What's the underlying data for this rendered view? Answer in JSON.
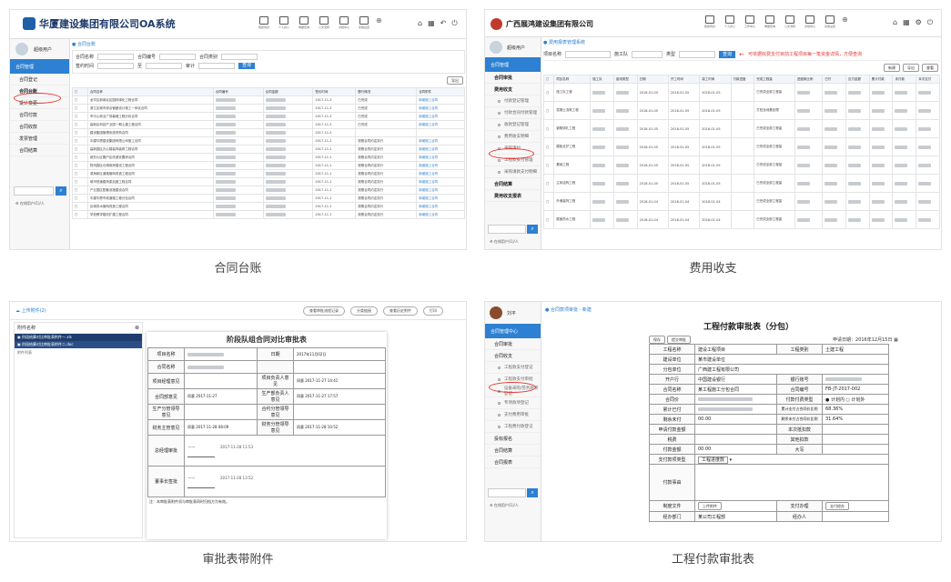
{
  "card1": {
    "caption": "合同台账",
    "logo_text": "华厦建设集团有限公司OA系统",
    "toolbar": [
      "我的待办",
      "个人办公",
      "单据查询",
      "公文流转",
      "文档中心",
      "系统设置"
    ],
    "user": "超级用户",
    "side_header": "合同管理",
    "side_items": [
      "合同登记",
      "合同台账",
      "设计变更",
      "合同付款",
      "合同收款",
      "发票管理",
      "合同结算"
    ],
    "highlighted": "合同台账",
    "online": "在线用户(1)/人",
    "breadcrumb": "合同台账",
    "filter_labels": [
      "合同名称",
      "合同编号",
      "合同类别",
      "签约时间",
      "至",
      "审计",
      "查询"
    ],
    "export_btn": "导出",
    "columns": [
      "合同名称",
      "合同编号",
      "合同金额",
      "签约时间",
      "履行情况",
      "合同附件"
    ],
    "rows": [
      [
        "龙华区新城北区园林绿化工程合同",
        "",
        "",
        "2017-11-3",
        "已完成",
        "新增施工合同"
      ],
      [
        "滨江区城市综合管廊设计施工一体化合同",
        "",
        "",
        "2017-11-2",
        "已完成",
        "新增施工合同"
      ],
      [
        "市中心商业广场幕墙工程分包合同",
        "",
        "",
        "2017-11-2",
        "已完成",
        "新增施工合同"
      ],
      [
        "高新区科技产业园一期土建工程合同",
        "",
        "",
        "2017-11-2",
        "已完成",
        "新增施工合同"
      ],
      [
        "建设集团管理系统采购合同",
        "",
        "",
        "2017-11-2",
        "",
        ""
      ],
      [
        "中建华厦建设集团有限公司施工合同",
        "",
        "",
        "2017-11-1",
        "按照合同约定执行",
        "新增施工合同"
      ],
      [
        "高新园区办公楼装饰装修工程合同",
        "",
        "",
        "2017-11-1",
        "按照合同约定执行",
        "新增施工合同"
      ],
      [
        "城东片区棚户区改造安置房合同",
        "",
        "",
        "2017-11-1",
        "按照合同约定执行",
        "新增施工合同"
      ],
      [
        "物流园区仓储用房建设工程合同",
        "",
        "",
        "2017-11-1",
        "按照合同约定执行",
        "新增施工合同"
      ],
      [
        "滨海新区道路管网改造工程合同",
        "",
        "",
        "2017-11-1",
        "按照合同约定执行",
        "新增施工合同"
      ],
      [
        "城市快速路桥梁加固工程合同",
        "",
        "",
        "2017-11-1",
        "按照合同约定执行",
        "新增施工合同"
      ],
      [
        "产业园区配套设施建设合同",
        "",
        "",
        "2017-11-1",
        "按照合同约定执行",
        "新增施工合同"
      ],
      [
        "中建华厦市政道路工程分包合同",
        "",
        "",
        "2017-11-1",
        "按照合同约定执行",
        "新增施工合同"
      ],
      [
        "区域供水管网改造工程合同",
        "",
        "",
        "2017-11-1",
        "按照合同约定执行",
        "新增施工合同"
      ],
      [
        "学校教学楼改扩建工程合同",
        "",
        "",
        "2017-11-1",
        "按照合同约定执行",
        "新增施工合同"
      ]
    ]
  },
  "card2": {
    "caption": "费用收支",
    "logo_text": "广西展鸿建设集团有限公司",
    "toolbar": [
      "我的待办",
      "个人办公",
      "工作中心",
      "单据查询",
      "公文流转",
      "文档中心",
      "系统设置"
    ],
    "user": "超级用户",
    "side_header": "合同管理",
    "side_items": [
      "合同审批",
      "费用收支",
      "合同结算",
      "费用收支报表"
    ],
    "sub_items": [
      "付款登记管理",
      "付款合同付款管理",
      "收款登记管理",
      "费用收支明细",
      "采购请付",
      "工程款支付管理",
      "采购请款支付明细"
    ],
    "highlighted": "费用收支明细",
    "online": "在线用户(1)/人",
    "breadcrumb": "费用报表管理系统",
    "filter_labels": [
      "项目名称",
      "施工队",
      "类型",
      "查询"
    ],
    "notice": "可依据收费支付目前工程项目每一笔资金详情，方便查询",
    "top_btns": [
      "新建",
      "导出",
      "查看"
    ],
    "columns": [
      "项目名称",
      "施工队",
      "费用类型",
      "日期",
      "开工时间",
      "竣工时间",
      "付款进度",
      "完成工程量",
      "进度款比例",
      "已付",
      "应付金额",
      "累计付款",
      "未付款",
      "本次支付"
    ],
    "rows": [
      [
        "施工队工程",
        "",
        "",
        "2018-01-05",
        "2018-01-05",
        "2018-01-05",
        "",
        "已完成全部工程量"
      ],
      [
        "混凝土浇筑工程",
        "",
        "",
        "2018-01-05",
        "2018-01-05",
        "2018-01-05",
        "",
        "打桩及地基处理"
      ],
      [
        "钢筋绑扎工程",
        "",
        "",
        "2018-01-05",
        "2018-01-05",
        "2018-01-05",
        "",
        "已完成全部工程量"
      ],
      [
        "模板支护工程",
        "",
        "",
        "2018-01-05",
        "2018-01-05",
        "2018-01-05",
        "",
        "已完成全部工程量"
      ],
      [
        "基础工程",
        "",
        "",
        "2018-01-05",
        "2018-01-05",
        "2018-01-05",
        "",
        "已完成全部工程量"
      ],
      [
        "主体结构工程",
        "",
        "",
        "2018-01-05",
        "2018-01-05",
        "2018-01-05",
        "",
        "已完成全部工程量"
      ],
      [
        "外墙装饰工程",
        "",
        "",
        "2018-01-04",
        "2018-01-04",
        "2018-01-04",
        "",
        "已完成全部工程量"
      ],
      [
        "屋面防水工程",
        "",
        "",
        "2018-01-04",
        "2018-01-04",
        "2018-01-04",
        "",
        "已完成全部工程量"
      ]
    ]
  },
  "card3": {
    "caption": "审批表带附件",
    "upload_btn": "上传附件(2)",
    "side_title": "附件名称",
    "files": [
      "阶段结算对比审批表附件一.xls",
      "阶段结算对比审批表附件二.doc"
    ],
    "file_footer": "附件列表",
    "top_pills": [
      "查看审批流程记录",
      "分类链接",
      "查看历史附件",
      "打印"
    ],
    "form_title": "阶段队组合同对比审批表",
    "rows": [
      {
        "l1": "项目名称",
        "v1": "",
        "l2": "日期",
        "v2": "2017年11月02日"
      },
      {
        "l1": "合同名称",
        "v1": "",
        "l2": "",
        "v2": ""
      },
      {
        "l1": "项目经理意见",
        "v1": "",
        "l2": "项目负责人意见",
        "v2": "同意 2017-11-27 14:41"
      },
      {
        "l1": "合同部意见",
        "v1": "同意 2017-11-27",
        "l2": "生产部负责人意见",
        "v2": "同意 2017-11-27 17:57"
      },
      {
        "l1": "生产分管领导意见",
        "v1": "",
        "l2": "合约分管领导意见",
        "v2": ""
      },
      {
        "l1": "财务主管意见",
        "v1": "同意 2017-11-28 08:09",
        "l2": "财务分管领导意见",
        "v2": "同意 2017-11-28 10:52"
      },
      {
        "l1": "总经理审批",
        "v1": "2017-11-28 11:53",
        "l2": "",
        "v2": ""
      },
      {
        "l1": "董事长签批",
        "v1": "",
        "l2": "",
        "v2": "2017-11-28 13:52"
      }
    ],
    "footnote": "注：本审批表附件须与审批表同时归档方为有效。"
  },
  "card4": {
    "caption": "工程付款审批表",
    "user": "刘平",
    "side_header": "合同管理中心",
    "side_items": [
      "合同审批",
      "合同收支",
      "投标报名",
      "合同结算",
      "合同报表"
    ],
    "sub_items": [
      "工程款支付登记",
      "工程款支付审批",
      "设备采购/劳务款项登记",
      "专项款项登记",
      "支付费用审批",
      "工程费付款登记"
    ],
    "highlighted": "工程款支付审批",
    "online": "在线用户(1)/人",
    "breadcrumb": "合同款项审批 - 新建",
    "tab_btns": [
      "保存",
      "提交审批"
    ],
    "form_title": "工程付款审批表（分包）",
    "apply_date_label": "申请日期：",
    "apply_date": "2016年12月15日",
    "project_label": "工程名称",
    "project_value": "建设工程项目",
    "project_type_label": "工程类别",
    "project_type_value": "土建工程",
    "build_unit_label": "建设单位",
    "build_unit_value": "某市建设单位",
    "contractor_label": "分包单位",
    "contractor_value": "广西建工程有限公司",
    "bank_label": "开户行",
    "bank_value": "中国建设银行",
    "account_label": "银行账号",
    "contract_name_label": "合同名称",
    "contract_name_value": "某工程施工分包合同",
    "contract_no_label": "合同编号",
    "contract_no_value": "FB-JT-2017-002",
    "contract_price_label": "合同价",
    "contract_price_value": "",
    "pay_type_label": "付款付费类型",
    "pay_type_value": "● 计划内 ○ 计划外",
    "paid_label": "累计已付",
    "ratio_label": "累计支付占合同价比例",
    "ratio_value": "68.36%",
    "unpaid_label": "剩余未付",
    "unpaid_value": "00.00",
    "unpaid_ratio_label": "剩余未付占合同价比例",
    "unpaid_ratio_value": "31.64%",
    "req_amount_label": "申请付款金额",
    "deduct_label": "本次抵扣款",
    "tax_label": "税费",
    "other_label": "其他扣款",
    "pay_amount_label": "付款金额",
    "pay_amount_value": "00.00",
    "upper_label": "大写",
    "method_label": "支付款项类型",
    "method_value": "工程进度款",
    "reason_label": "付款事由",
    "attach_label": "制度文件",
    "attach_btn": "上传附件",
    "payee_label": "支付办理",
    "payee_btn": "支付经办",
    "handler_label": "经办部门",
    "handler_value": "某公司工程部",
    "agent_label": "经办人"
  }
}
